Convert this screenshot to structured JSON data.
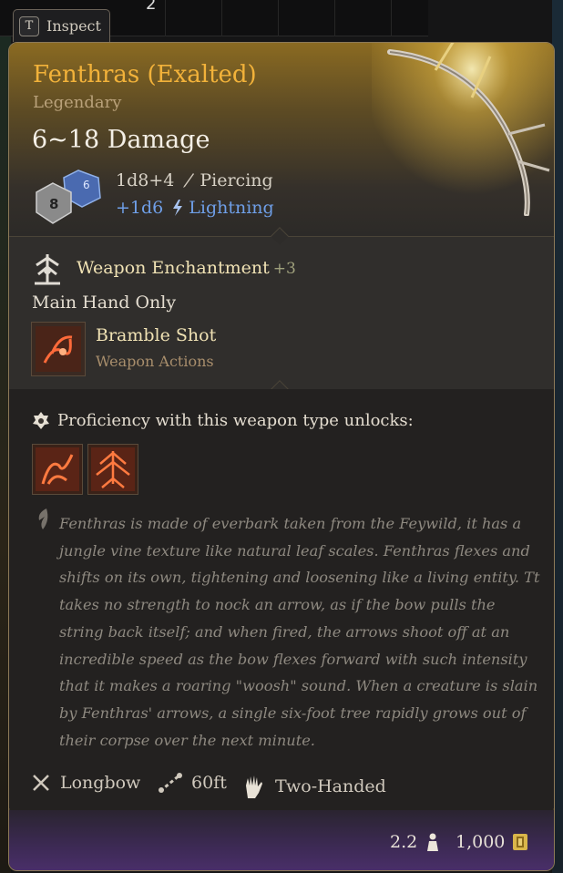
{
  "background": {
    "stack_count": "2"
  },
  "inspect_tab": {
    "key": "T",
    "label": "Inspect"
  },
  "item": {
    "name": "Fenthras (Exalted)",
    "rarity": "Legendary",
    "damage_total": "6~18 Damage",
    "damage_lines": [
      {
        "dice": "1d8+4",
        "type": "Piercing",
        "icon": "piercing-icon"
      },
      {
        "dice": "+1d6",
        "type": "Lightning",
        "icon": "lightning-icon"
      }
    ],
    "enchantment": {
      "label": "Weapon Enchantment",
      "bonus": "+3",
      "icon": "enchantment-icon"
    },
    "restriction": "Main Hand Only",
    "action": {
      "name": "Bramble Shot",
      "category": "Weapon Actions",
      "icon": "bramble-shot-icon"
    },
    "proficiency": {
      "label": "Proficiency with this weapon type unlocks:",
      "abilities": [
        {
          "icon": "piercing-shot-icon"
        },
        {
          "icon": "mobile-shot-icon"
        }
      ]
    },
    "lore": "Fenthras is made of everbark taken from the Feywild, it has a jungle vine texture like natural leaf scales. Fenthras flexes and shifts on its own, tightening and loosening like a living entity. Tt takes no strength to nock an arrow, as if the bow pulls the string back itself; and when fired, the arrows shoot off at an incredible speed as the bow flexes forward with such intensity that it makes a roaring \"woosh\" sound. When a creature is slain by Fenthras' arrows, a single six-foot tree rapidly grows out of their corpse over the next minute.",
    "properties": [
      {
        "label": "Longbow",
        "icon": "crossed-weapons-icon"
      },
      {
        "label": "60ft",
        "icon": "range-icon"
      },
      {
        "label": "Two-Handed",
        "icon": "two-handed-icon"
      }
    ],
    "weight": "2.2",
    "value": "1,000"
  },
  "colors": {
    "title": "#f2b23a",
    "lightning": "#6f9fe8",
    "gold_text": "#f0e2b4"
  }
}
